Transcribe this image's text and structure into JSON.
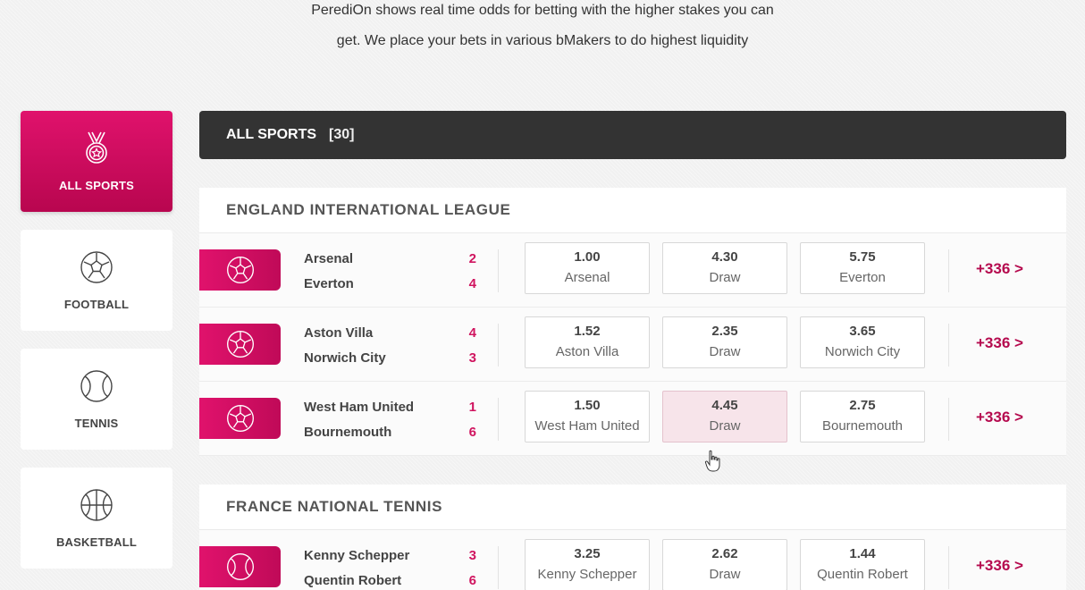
{
  "intro": {
    "line1": "PerediOn shows real time odds for betting with the higher stakes you can",
    "line2": "get. We place your bets in various bMakers to do highest liquidity"
  },
  "sidebar": {
    "items": [
      {
        "label": "ALL SPORTS",
        "icon": "medal-icon",
        "active": true
      },
      {
        "label": "FOOTBALL",
        "icon": "football-icon",
        "active": false
      },
      {
        "label": "TENNIS",
        "icon": "tennis-ball-icon",
        "active": false
      },
      {
        "label": "BASKETBALL",
        "icon": "basketball-icon",
        "active": false
      }
    ]
  },
  "header": {
    "title": "ALL SPORTS",
    "count": "[30]"
  },
  "leagues": [
    {
      "title": "ENGLAND INTERNATIONAL LEAGUE",
      "matches": [
        {
          "icon": "football-icon",
          "team1": "Arsenal",
          "team2": "Everton",
          "score1": "2",
          "score2": "4",
          "odds": [
            {
              "value": "1.00",
              "name": "Arsenal"
            },
            {
              "value": "4.30",
              "name": "Draw"
            },
            {
              "value": "5.75",
              "name": "Everton"
            }
          ],
          "more": "+336 >"
        },
        {
          "icon": "football-icon",
          "team1": "Aston Villa",
          "team2": "Norwich City",
          "score1": "4",
          "score2": "3",
          "odds": [
            {
              "value": "1.52",
              "name": "Aston Villa"
            },
            {
              "value": "2.35",
              "name": "Draw"
            },
            {
              "value": "3.65",
              "name": "Norwich City"
            }
          ],
          "more": "+336 >"
        },
        {
          "icon": "football-icon",
          "team1": "West Ham United",
          "team2": "Bournemouth",
          "score1": "1",
          "score2": "6",
          "odds": [
            {
              "value": "1.50",
              "name": "West Ham United"
            },
            {
              "value": "4.45",
              "name": "Draw",
              "selected": true
            },
            {
              "value": "2.75",
              "name": "Bournemouth"
            }
          ],
          "more": "+336 >"
        }
      ]
    },
    {
      "title": "FRANCE NATIONAL TENNIS",
      "matches": [
        {
          "icon": "tennis-ball-icon",
          "team1": "Kenny Schepper",
          "team2": "Quentin Robert",
          "score1": "3",
          "score2": "6",
          "odds": [
            {
              "value": "3.25",
              "name": "Kenny Schepper"
            },
            {
              "value": "2.62",
              "name": "Draw"
            },
            {
              "value": "1.44",
              "name": "Quentin Robert"
            }
          ],
          "more": "+336 >"
        }
      ]
    }
  ],
  "colors": {
    "accent": "#d0145f",
    "header_bg": "#333333",
    "selected_odd_bg": "#f7e4ea"
  }
}
